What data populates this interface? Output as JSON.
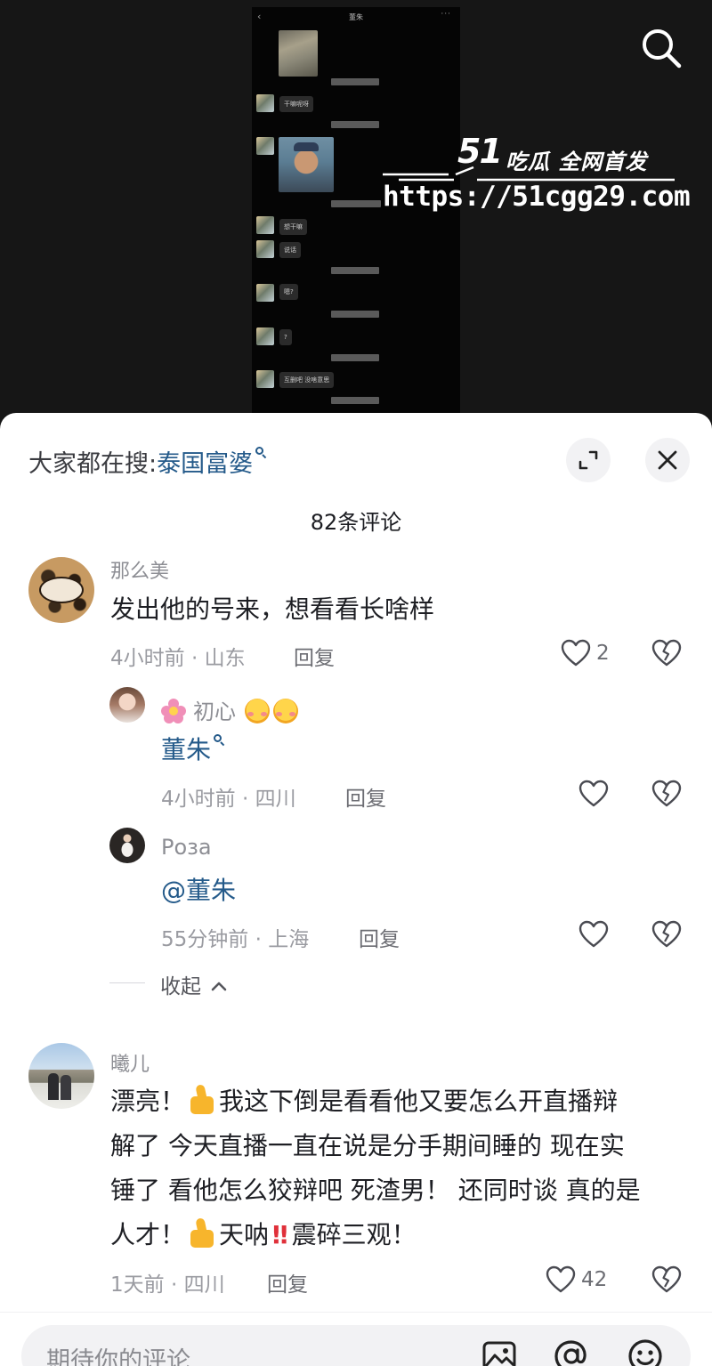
{
  "video": {
    "chat_screenshot": {
      "back_glyph": "‹",
      "title": "董朱",
      "more_glyph": "···",
      "messages": [
        {
          "kind": "image"
        },
        {
          "kind": "text",
          "text": "干嘛呢呀"
        },
        {
          "kind": "image"
        },
        {
          "kind": "text",
          "text": "想干嘛"
        },
        {
          "kind": "text",
          "text": "说话"
        },
        {
          "kind": "text",
          "text": "嗯?"
        },
        {
          "kind": "text",
          "text": "?"
        },
        {
          "kind": "text",
          "text": "互删吧 没啥意思"
        }
      ]
    },
    "watermark": {
      "logo_number": "51",
      "tagline": "吃瓜 全网首发",
      "url": "https://51cgg29.com"
    },
    "search_icon": "search-icon"
  },
  "sheet": {
    "hot_search_label": "大家都在搜:",
    "hot_search_term": "泰国富婆",
    "expand_icon": "expand-icon",
    "close_icon": "close-icon",
    "comment_count_title": "82条评论",
    "comments": [
      {
        "user": "那么美",
        "text": "发出他的号来，想看看长啥样",
        "meta": "4小时前 · 山东",
        "reply_label": "回复",
        "likes": "2"
      },
      {
        "user": "初心",
        "mention": "董朱",
        "meta": "4小时前 · 四川",
        "reply_label": "回复"
      },
      {
        "user": "Роза",
        "mention": "@董朱",
        "meta": "55分钟前 · 上海",
        "reply_label": "回复"
      },
      {
        "user": "曦儿",
        "text_lines": [
          "漂亮！",
          "我这下倒是看看他又要怎么开直播辩",
          "解了 今天直播一直在说是分手期间睡的 现在实",
          "锤了 看他怎么狡辩吧 死渣男！ 还同时谈 真的是",
          "人才！",
          "天呐",
          "震碎三观！"
        ],
        "meta": "1天前 · 四川",
        "reply_label": "回复",
        "likes": "42"
      }
    ],
    "collapse_label": "收起"
  },
  "input_bar": {
    "placeholder": "期待你的评论",
    "icons": [
      "image-icon",
      "at-icon",
      "emoji-icon"
    ]
  },
  "colors": {
    "mention_blue": "#245a8a",
    "video_bg": "#161616",
    "sheet_bg": "#ffffff",
    "input_bg": "#f2f2f4"
  }
}
